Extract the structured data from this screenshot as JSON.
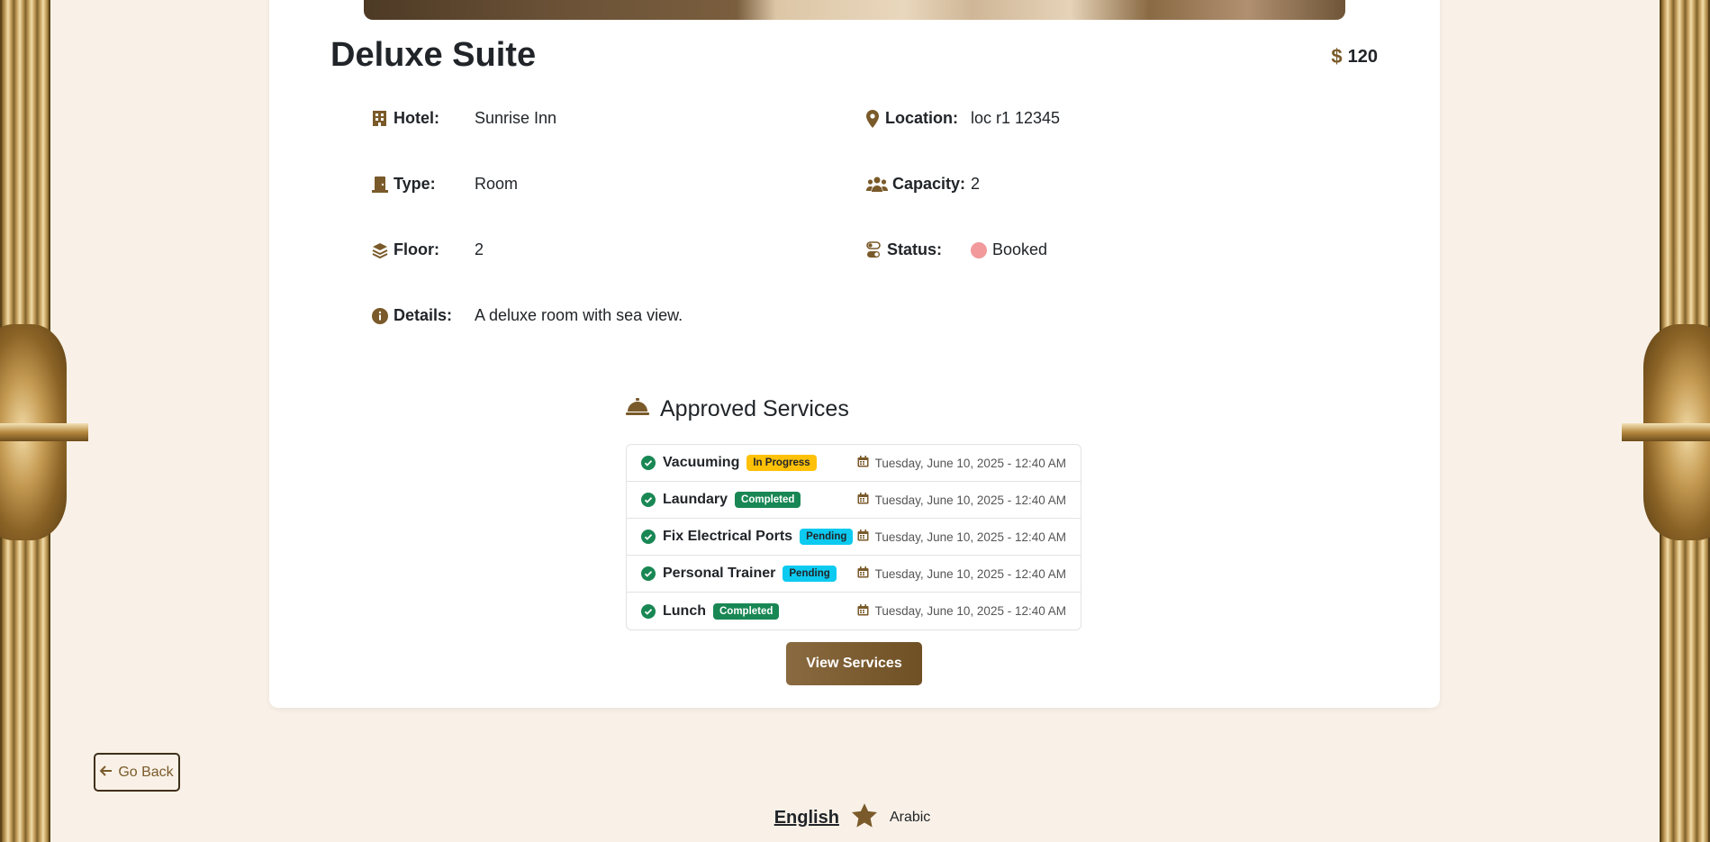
{
  "room": {
    "title": "Deluxe Suite",
    "price": "120",
    "price_icon": "dollar-icon"
  },
  "details": {
    "hotel_label": "Hotel:",
    "hotel_value": "Sunrise Inn",
    "location_label": "Location:",
    "location_value": "loc r1 12345",
    "type_label": "Type:",
    "type_value": "Room",
    "capacity_label": "Capacity:",
    "capacity_value": "2",
    "floor_label": "Floor:",
    "floor_value": "2",
    "status_label": "Status:",
    "status_value": "Booked",
    "status_color": "#f1999b",
    "details_label": "Details:",
    "details_value": "A deluxe room with sea view."
  },
  "services": {
    "heading": "Approved Services",
    "items": [
      {
        "name": "Vacuuming",
        "status": "In Progress",
        "date": "Tuesday, June 10, 2025 - 12:40 AM"
      },
      {
        "name": "Laundary",
        "status": "Completed",
        "date": "Tuesday, June 10, 2025 - 12:40 AM"
      },
      {
        "name": "Fix Electrical Ports",
        "status": "Pending",
        "date": "Tuesday, June 10, 2025 - 12:40 AM"
      },
      {
        "name": "Personal Trainer",
        "status": "Pending",
        "date": "Tuesday, June 10, 2025 - 12:40 AM"
      },
      {
        "name": "Lunch",
        "status": "Completed",
        "date": "Tuesday, June 10, 2025 - 12:40 AM"
      }
    ],
    "view_button": "View Services"
  },
  "nav": {
    "go_back": "Go Back"
  },
  "language": {
    "english": "English",
    "arabic": "Arabic"
  },
  "colors": {
    "accent": "#7a5a2a",
    "completed": "#198754",
    "in_progress": "#ffc107",
    "pending": "#0dcaf0"
  }
}
